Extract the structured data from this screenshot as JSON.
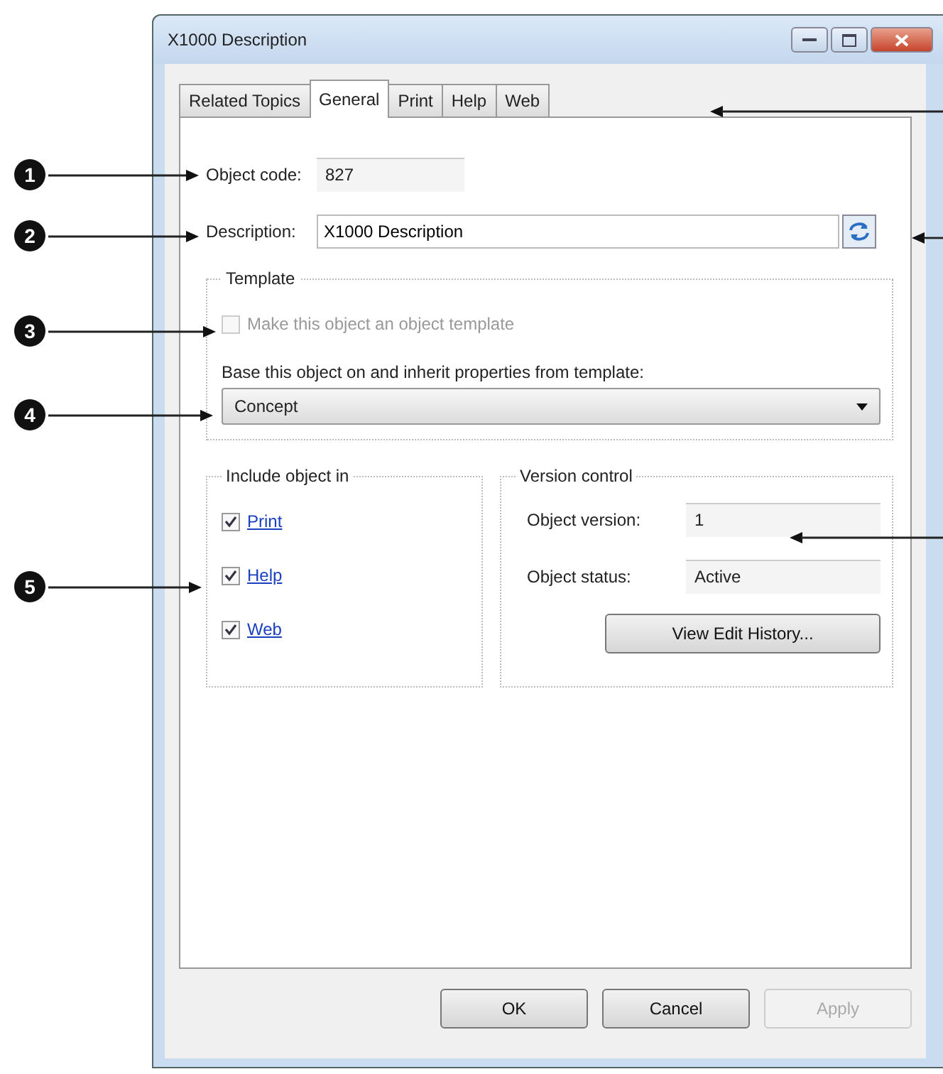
{
  "window": {
    "title": "X1000 Description"
  },
  "tabs": [
    {
      "label": "Related Topics",
      "selected": false
    },
    {
      "label": "General",
      "selected": true
    },
    {
      "label": "Print",
      "selected": false
    },
    {
      "label": "Help",
      "selected": false
    },
    {
      "label": "Web",
      "selected": false
    }
  ],
  "object_code": {
    "label": "Object code:",
    "value": "827"
  },
  "description": {
    "label": "Description:",
    "value": "X1000 Description"
  },
  "template": {
    "title": "Template",
    "make_template": {
      "label": "Make this object an object template",
      "checked": false,
      "disabled": true
    },
    "base_label": "Base this object on and inherit properties from template:",
    "base_value": "Concept"
  },
  "include": {
    "title": "Include object in",
    "items": [
      {
        "label": "Print",
        "checked": true
      },
      {
        "label": "Help",
        "checked": true
      },
      {
        "label": "Web",
        "checked": true
      }
    ]
  },
  "version_control": {
    "title": "Version control",
    "version": {
      "label": "Object version:",
      "value": "1"
    },
    "status": {
      "label": "Object status:",
      "value": "Active"
    },
    "history_button": "View Edit History..."
  },
  "buttons": [
    {
      "label": "OK",
      "disabled": false
    },
    {
      "label": "Cancel",
      "disabled": false
    },
    {
      "label": "Apply",
      "disabled": true
    }
  ],
  "callouts": [
    {
      "number": "1"
    },
    {
      "number": "2"
    },
    {
      "number": "3"
    },
    {
      "number": "4"
    },
    {
      "number": "5"
    }
  ]
}
